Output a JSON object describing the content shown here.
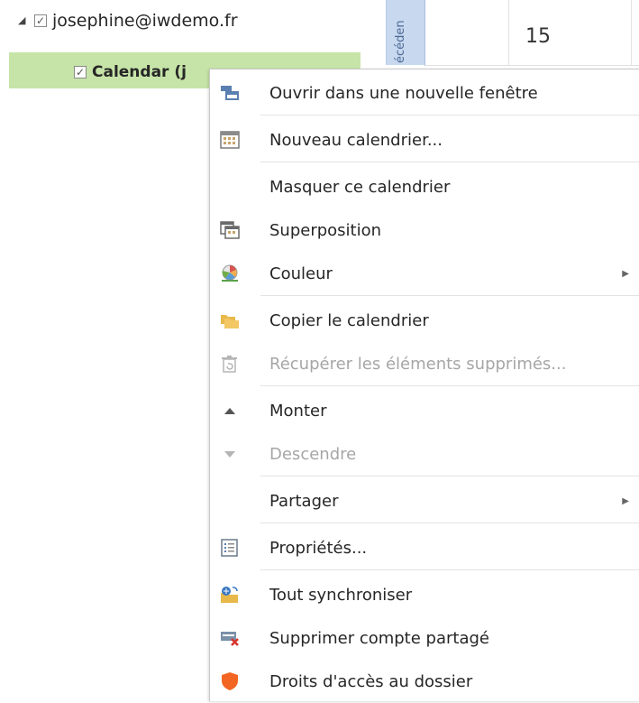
{
  "nav": {
    "account": "josephine@iwdemo.fr",
    "calendar": "Calendar (j"
  },
  "grid": {
    "prev_label": "écéden",
    "day_number": "15"
  },
  "menu": {
    "items": [
      {
        "label": "Ouvrir dans une nouvelle fenêtre",
        "icon": "new-window-icon"
      },
      {
        "label": "Nouveau calendrier...",
        "icon": "new-calendar-icon"
      },
      {
        "label": "Masquer ce calendrier",
        "icon": ""
      },
      {
        "label": "Superposition",
        "icon": "overlay-icon"
      },
      {
        "label": "Couleur",
        "icon": "color-palette-icon",
        "submenu": true
      },
      {
        "label": "Copier le calendrier",
        "icon": "copy-folder-icon"
      },
      {
        "label": "Récupérer les éléments supprimés...",
        "icon": "recover-deleted-icon",
        "disabled": true
      },
      {
        "label": "Monter",
        "icon": "up-triangle-icon"
      },
      {
        "label": "Descendre",
        "icon": "down-triangle-icon",
        "disabled": true
      },
      {
        "label": "Partager",
        "icon": "",
        "submenu": true
      },
      {
        "label": "Propriétés...",
        "icon": "properties-icon"
      },
      {
        "label": "Tout synchroniser",
        "icon": "sync-all-icon"
      },
      {
        "label": "Supprimer compte partagé",
        "icon": "remove-shared-icon"
      },
      {
        "label": "Droits d'accès au dossier",
        "icon": "shield-icon"
      }
    ],
    "submenu_glyph": "▶"
  },
  "colors": {
    "selected_bg": "#c6e4a8",
    "prev_bar": "#c7d8ef",
    "disabled_text": "#a6a6a6"
  }
}
